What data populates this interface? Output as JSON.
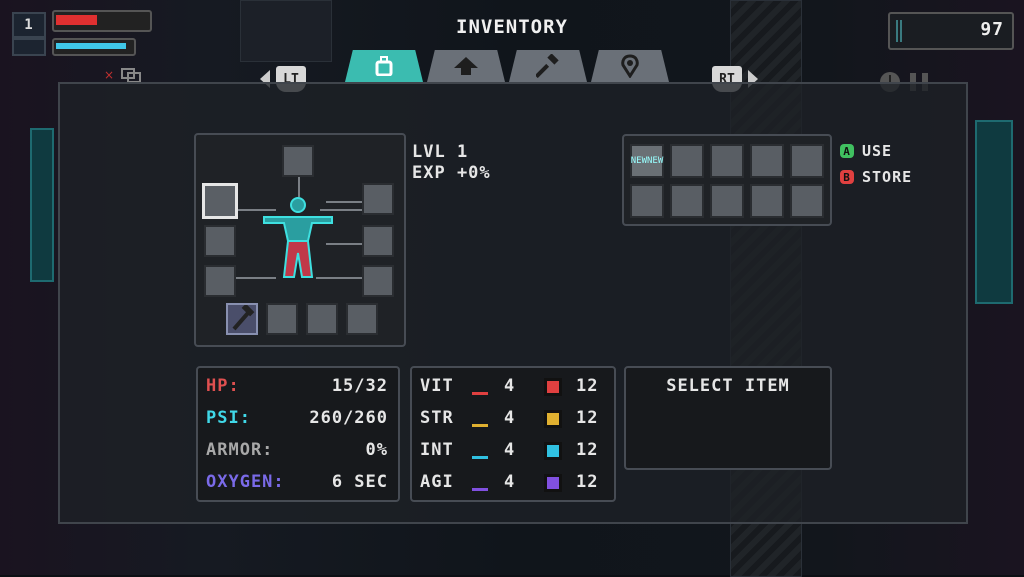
{
  "hud": {
    "level": "1",
    "hp_fraction": 0.47,
    "psi_fraction": 0.95,
    "money": "97"
  },
  "title": "INVENTORY",
  "shoulder_left": "LT",
  "shoulder_right": "RT",
  "tabs": [
    {
      "icon": "backpack-icon",
      "active": true
    },
    {
      "icon": "up-arrow-icon",
      "active": false
    },
    {
      "icon": "hammer-icon",
      "active": false
    },
    {
      "icon": "map-pin-icon",
      "active": false
    }
  ],
  "character": {
    "level_line": "LVL  1",
    "exp_line": "EXP +0%"
  },
  "inventory": {
    "first_item_label": "NEWNEW"
  },
  "legend": {
    "a_label": "USE",
    "b_label": "STORE"
  },
  "stats": {
    "hp_label": "HP:",
    "hp_value": "15/32",
    "psi_label": "PSI:",
    "psi_value": "260/260",
    "armor_label": "ARMOR:",
    "armor_value": "0%",
    "oxygen_label": "OXYGEN:",
    "oxygen_value": "6 SEC"
  },
  "attributes": [
    {
      "label": "VIT",
      "value": "4",
      "res_value": "12",
      "color": "#e04040"
    },
    {
      "label": "STR",
      "value": "4",
      "res_value": "12",
      "color": "#e0b030"
    },
    {
      "label": "INT",
      "value": "4",
      "res_value": "12",
      "color": "#30c0e0"
    },
    {
      "label": "AGI",
      "value": "4",
      "res_value": "12",
      "color": "#8050e0"
    }
  ],
  "select_item": "SELECT ITEM",
  "colors": {
    "hp": "#e05050",
    "psi": "#40d8e8",
    "armor": "#a8a8a8",
    "oxygen": "#7a6ae8",
    "accent": "#3bbcb0"
  }
}
